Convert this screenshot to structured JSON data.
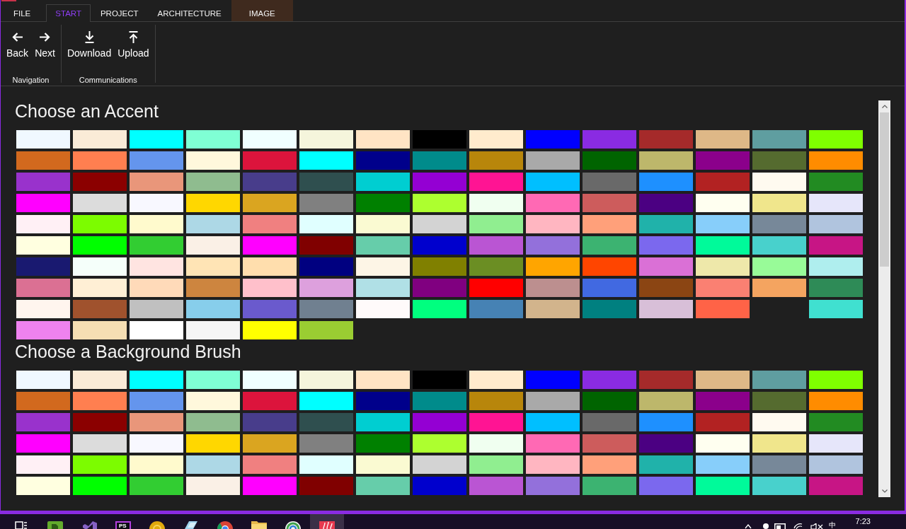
{
  "ribbon": {
    "tabs": [
      {
        "label": "FILE",
        "selected": false,
        "contextual": false
      },
      {
        "label": "START",
        "selected": true,
        "contextual": false
      },
      {
        "label": "PROJECT",
        "selected": false,
        "contextual": false
      },
      {
        "label": "ARCHITECTURE",
        "selected": false,
        "contextual": false
      },
      {
        "label": "IMAGE",
        "selected": false,
        "contextual": true
      }
    ],
    "groups": [
      {
        "label": "Navigation",
        "buttons": [
          {
            "label": "Back",
            "kind": "back"
          },
          {
            "label": "Next",
            "kind": "next"
          }
        ]
      },
      {
        "label": "Communications",
        "buttons": [
          {
            "label": "Download",
            "kind": "download"
          },
          {
            "label": "Upload",
            "kind": "upload"
          }
        ]
      }
    ]
  },
  "sections": [
    {
      "title": "Choose an Accent",
      "swatches": [
        {
          "kind": "swatch",
          "color": "#f0f8ff"
        },
        {
          "kind": "swatch",
          "color": "#faebd7"
        },
        {
          "kind": "swatch",
          "color": "#00ffff"
        },
        {
          "kind": "swatch",
          "color": "#7fffd4"
        },
        {
          "kind": "swatch",
          "color": "#f0ffff"
        },
        {
          "kind": "swatch",
          "color": "#f5f5dc"
        },
        {
          "kind": "swatch",
          "color": "#ffe4c4"
        },
        {
          "kind": "swatch",
          "color": "#000000"
        },
        {
          "kind": "swatch",
          "color": "#ffebcd"
        },
        {
          "kind": "swatch",
          "color": "#0000ff"
        },
        {
          "kind": "swatch",
          "color": "#8a2be2"
        },
        {
          "kind": "swatch",
          "color": "#a52a2a"
        },
        {
          "kind": "swatch",
          "color": "#deb887"
        },
        {
          "kind": "swatch",
          "color": "#5f9ea0"
        },
        {
          "kind": "swatch",
          "color": "#7fff00"
        },
        {
          "kind": "swatch",
          "color": "#d2691e"
        },
        {
          "kind": "swatch",
          "color": "#ff7f50"
        },
        {
          "kind": "swatch",
          "color": "#6495ed"
        },
        {
          "kind": "swatch",
          "color": "#fff8dc"
        },
        {
          "kind": "swatch",
          "color": "#dc143c"
        },
        {
          "kind": "swatch",
          "color": "#00ffff"
        },
        {
          "kind": "swatch",
          "color": "#00008b"
        },
        {
          "kind": "swatch",
          "color": "#008b8b"
        },
        {
          "kind": "swatch",
          "color": "#b8860b"
        },
        {
          "kind": "swatch",
          "color": "#a9a9a9"
        },
        {
          "kind": "swatch",
          "color": "#006400"
        },
        {
          "kind": "swatch",
          "color": "#bdb76b"
        },
        {
          "kind": "swatch",
          "color": "#8b008b"
        },
        {
          "kind": "swatch",
          "color": "#556b2f"
        },
        {
          "kind": "swatch",
          "color": "#ff8c00"
        },
        {
          "kind": "swatch",
          "color": "#9932cc"
        },
        {
          "kind": "swatch",
          "color": "#8b0000"
        },
        {
          "kind": "swatch",
          "color": "#e9967a"
        },
        {
          "kind": "swatch",
          "color": "#8fbc8f"
        },
        {
          "kind": "swatch",
          "color": "#483d8b"
        },
        {
          "kind": "swatch",
          "color": "#2f4f4f"
        },
        {
          "kind": "swatch",
          "color": "#00ced1"
        },
        {
          "kind": "swatch",
          "color": "#9400d3"
        },
        {
          "kind": "swatch",
          "color": "#ff1493"
        },
        {
          "kind": "swatch",
          "color": "#00bfff"
        },
        {
          "kind": "swatch",
          "color": "#696969"
        },
        {
          "kind": "swatch",
          "color": "#1e90ff"
        },
        {
          "kind": "swatch",
          "color": "#b22222"
        },
        {
          "kind": "swatch",
          "color": "#fffaf0"
        },
        {
          "kind": "swatch",
          "color": "#228b22"
        },
        {
          "kind": "swatch",
          "color": "#ff00ff"
        },
        {
          "kind": "swatch",
          "color": "#dcdcdc"
        },
        {
          "kind": "swatch",
          "color": "#f8f8ff"
        },
        {
          "kind": "swatch",
          "color": "#ffd700"
        },
        {
          "kind": "swatch",
          "color": "#daa520"
        },
        {
          "kind": "swatch",
          "color": "#808080"
        },
        {
          "kind": "swatch",
          "color": "#008000"
        },
        {
          "kind": "swatch",
          "color": "#adff2f"
        },
        {
          "kind": "swatch",
          "color": "#f0fff0"
        },
        {
          "kind": "swatch",
          "color": "#ff69b4"
        },
        {
          "kind": "swatch",
          "color": "#cd5c5c"
        },
        {
          "kind": "swatch",
          "color": "#4b0082"
        },
        {
          "kind": "swatch",
          "color": "#fffff0"
        },
        {
          "kind": "swatch",
          "color": "#f0e68c"
        },
        {
          "kind": "swatch",
          "color": "#e6e6fa"
        },
        {
          "kind": "swatch",
          "color": "#fff0f5"
        },
        {
          "kind": "swatch",
          "color": "#7cfc00"
        },
        {
          "kind": "swatch",
          "color": "#fffacd"
        },
        {
          "kind": "swatch",
          "color": "#add8e6"
        },
        {
          "kind": "swatch",
          "color": "#f08080"
        },
        {
          "kind": "swatch",
          "color": "#e0ffff"
        },
        {
          "kind": "swatch",
          "color": "#fafad2"
        },
        {
          "kind": "swatch",
          "color": "#d3d3d3"
        },
        {
          "kind": "swatch",
          "color": "#90ee90"
        },
        {
          "kind": "swatch",
          "color": "#ffb6c1"
        },
        {
          "kind": "swatch",
          "color": "#ffa07a"
        },
        {
          "kind": "swatch",
          "color": "#20b2aa"
        },
        {
          "kind": "swatch",
          "color": "#87cefa"
        },
        {
          "kind": "swatch",
          "color": "#778899"
        },
        {
          "kind": "swatch",
          "color": "#b0c4de"
        },
        {
          "kind": "swatch",
          "color": "#ffffe0"
        },
        {
          "kind": "swatch",
          "color": "#00ff00"
        },
        {
          "kind": "swatch",
          "color": "#32cd32"
        },
        {
          "kind": "swatch",
          "color": "#faf0e6"
        },
        {
          "kind": "swatch",
          "color": "#ff00ff"
        },
        {
          "kind": "swatch",
          "color": "#800000"
        },
        {
          "kind": "swatch",
          "color": "#66cdaa"
        },
        {
          "kind": "swatch",
          "color": "#0000cd"
        },
        {
          "kind": "swatch",
          "color": "#ba55d3"
        },
        {
          "kind": "swatch",
          "color": "#9370db"
        },
        {
          "kind": "swatch",
          "color": "#3cb371"
        },
        {
          "kind": "swatch",
          "color": "#7b68ee"
        },
        {
          "kind": "swatch",
          "color": "#00fa9a"
        },
        {
          "kind": "swatch",
          "color": "#48d1cc"
        },
        {
          "kind": "swatch",
          "color": "#c71585"
        },
        {
          "kind": "swatch",
          "color": "#191970"
        },
        {
          "kind": "swatch",
          "color": "#f5fffa"
        },
        {
          "kind": "swatch",
          "color": "#ffe4e1"
        },
        {
          "kind": "swatch",
          "color": "#ffe4b5"
        },
        {
          "kind": "swatch",
          "color": "#ffdead"
        },
        {
          "kind": "swatch",
          "color": "#000080"
        },
        {
          "kind": "swatch",
          "color": "#fdf5e6"
        },
        {
          "kind": "swatch",
          "color": "#808000"
        },
        {
          "kind": "swatch",
          "color": "#6b8e23"
        },
        {
          "kind": "swatch",
          "color": "#ffa500"
        },
        {
          "kind": "swatch",
          "color": "#ff4500"
        },
        {
          "kind": "swatch",
          "color": "#da70d6"
        },
        {
          "kind": "swatch",
          "color": "#eee8aa"
        },
        {
          "kind": "swatch",
          "color": "#98fb98"
        },
        {
          "kind": "swatch",
          "color": "#afeeee"
        },
        {
          "kind": "swatch",
          "color": "#db7093"
        },
        {
          "kind": "swatch",
          "color": "#ffefd5"
        },
        {
          "kind": "swatch",
          "color": "#ffdab9"
        },
        {
          "kind": "swatch",
          "color": "#cd853f"
        },
        {
          "kind": "swatch",
          "color": "#ffc0cb"
        },
        {
          "kind": "swatch",
          "color": "#dda0dd"
        },
        {
          "kind": "swatch",
          "color": "#b0e0e6"
        },
        {
          "kind": "swatch",
          "color": "#800080"
        },
        {
          "kind": "swatch",
          "color": "#ff0000"
        },
        {
          "kind": "swatch",
          "color": "#bc8f8f"
        },
        {
          "kind": "swatch",
          "color": "#4169e1"
        },
        {
          "kind": "swatch",
          "color": "#8b4513"
        },
        {
          "kind": "swatch",
          "color": "#fa8072"
        },
        {
          "kind": "swatch",
          "color": "#f4a460"
        },
        {
          "kind": "swatch",
          "color": "#2e8b57"
        },
        {
          "kind": "swatch",
          "color": "#fff5ee"
        },
        {
          "kind": "swatch",
          "color": "#a0522d"
        },
        {
          "kind": "swatch",
          "color": "#c0c0c0"
        },
        {
          "kind": "swatch",
          "color": "#87ceeb"
        },
        {
          "kind": "swatch",
          "color": "#6a5acd"
        },
        {
          "kind": "swatch",
          "color": "#708090"
        },
        {
          "kind": "swatch",
          "color": "#fffafa"
        },
        {
          "kind": "swatch",
          "color": "#00ff7f"
        },
        {
          "kind": "swatch",
          "color": "#4682b4"
        },
        {
          "kind": "swatch",
          "color": "#d2b48c"
        },
        {
          "kind": "swatch",
          "color": "#008080"
        },
        {
          "kind": "swatch",
          "color": "#d8bfd8"
        },
        {
          "kind": "swatch",
          "color": "#ff6347"
        },
        {
          "kind": "empty"
        },
        {
          "kind": "swatch",
          "color": "#40e0d0"
        },
        {
          "kind": "swatch",
          "color": "#ee82ee"
        },
        {
          "kind": "swatch",
          "color": "#f5deb3"
        },
        {
          "kind": "swatch",
          "color": "#ffffff"
        },
        {
          "kind": "swatch",
          "color": "#f5f5f5"
        },
        {
          "kind": "swatch",
          "color": "#ffff00"
        },
        {
          "kind": "swatch",
          "color": "#9acd32"
        }
      ]
    },
    {
      "title": "Choose a Background Brush",
      "swatches": [
        {
          "kind": "swatch",
          "color": "#f0f8ff"
        },
        {
          "kind": "swatch",
          "color": "#faebd7"
        },
        {
          "kind": "swatch",
          "color": "#00ffff"
        },
        {
          "kind": "swatch",
          "color": "#7fffd4"
        },
        {
          "kind": "swatch",
          "color": "#f0ffff"
        },
        {
          "kind": "swatch",
          "color": "#f5f5dc"
        },
        {
          "kind": "swatch",
          "color": "#ffe4c4"
        },
        {
          "kind": "swatch",
          "color": "#000000"
        },
        {
          "kind": "swatch",
          "color": "#ffebcd"
        },
        {
          "kind": "swatch",
          "color": "#0000ff"
        },
        {
          "kind": "swatch",
          "color": "#8a2be2"
        },
        {
          "kind": "swatch",
          "color": "#a52a2a"
        },
        {
          "kind": "swatch",
          "color": "#deb887"
        },
        {
          "kind": "swatch",
          "color": "#5f9ea0"
        },
        {
          "kind": "swatch",
          "color": "#7fff00"
        },
        {
          "kind": "swatch",
          "color": "#d2691e"
        },
        {
          "kind": "swatch",
          "color": "#ff7f50"
        },
        {
          "kind": "swatch",
          "color": "#6495ed"
        },
        {
          "kind": "swatch",
          "color": "#fff8dc"
        },
        {
          "kind": "swatch",
          "color": "#dc143c"
        },
        {
          "kind": "swatch",
          "color": "#00ffff"
        },
        {
          "kind": "swatch",
          "color": "#00008b"
        },
        {
          "kind": "swatch",
          "color": "#008b8b"
        },
        {
          "kind": "swatch",
          "color": "#b8860b"
        },
        {
          "kind": "swatch",
          "color": "#a9a9a9"
        },
        {
          "kind": "swatch",
          "color": "#006400"
        },
        {
          "kind": "swatch",
          "color": "#bdb76b"
        },
        {
          "kind": "swatch",
          "color": "#8b008b"
        },
        {
          "kind": "swatch",
          "color": "#556b2f"
        },
        {
          "kind": "swatch",
          "color": "#ff8c00"
        },
        {
          "kind": "swatch",
          "color": "#9932cc"
        },
        {
          "kind": "swatch",
          "color": "#8b0000"
        },
        {
          "kind": "swatch",
          "color": "#e9967a"
        },
        {
          "kind": "swatch",
          "color": "#8fbc8f"
        },
        {
          "kind": "swatch",
          "color": "#483d8b"
        },
        {
          "kind": "swatch",
          "color": "#2f4f4f"
        },
        {
          "kind": "swatch",
          "color": "#00ced1"
        },
        {
          "kind": "swatch",
          "color": "#9400d3"
        },
        {
          "kind": "swatch",
          "color": "#ff1493"
        },
        {
          "kind": "swatch",
          "color": "#00bfff"
        },
        {
          "kind": "swatch",
          "color": "#696969"
        },
        {
          "kind": "swatch",
          "color": "#1e90ff"
        },
        {
          "kind": "swatch",
          "color": "#b22222"
        },
        {
          "kind": "swatch",
          "color": "#fffaf0"
        },
        {
          "kind": "swatch",
          "color": "#228b22"
        },
        {
          "kind": "swatch",
          "color": "#ff00ff"
        },
        {
          "kind": "swatch",
          "color": "#dcdcdc"
        },
        {
          "kind": "swatch",
          "color": "#f8f8ff"
        },
        {
          "kind": "swatch",
          "color": "#ffd700"
        },
        {
          "kind": "swatch",
          "color": "#daa520"
        },
        {
          "kind": "swatch",
          "color": "#808080"
        },
        {
          "kind": "swatch",
          "color": "#008000"
        },
        {
          "kind": "swatch",
          "color": "#adff2f"
        },
        {
          "kind": "swatch",
          "color": "#f0fff0"
        },
        {
          "kind": "swatch",
          "color": "#ff69b4"
        },
        {
          "kind": "swatch",
          "color": "#cd5c5c"
        },
        {
          "kind": "swatch",
          "color": "#4b0082"
        },
        {
          "kind": "swatch",
          "color": "#fffff0"
        },
        {
          "kind": "swatch",
          "color": "#f0e68c"
        },
        {
          "kind": "swatch",
          "color": "#e6e6fa"
        },
        {
          "kind": "swatch",
          "color": "#fff0f5"
        },
        {
          "kind": "swatch",
          "color": "#7cfc00"
        },
        {
          "kind": "swatch",
          "color": "#fffacd"
        },
        {
          "kind": "swatch",
          "color": "#add8e6"
        },
        {
          "kind": "swatch",
          "color": "#f08080"
        },
        {
          "kind": "swatch",
          "color": "#e0ffff"
        },
        {
          "kind": "swatch",
          "color": "#fafad2"
        },
        {
          "kind": "swatch",
          "color": "#d3d3d3"
        },
        {
          "kind": "swatch",
          "color": "#90ee90"
        },
        {
          "kind": "swatch",
          "color": "#ffb6c1"
        },
        {
          "kind": "swatch",
          "color": "#ffa07a"
        },
        {
          "kind": "swatch",
          "color": "#20b2aa"
        },
        {
          "kind": "swatch",
          "color": "#87cefa"
        },
        {
          "kind": "swatch",
          "color": "#778899"
        },
        {
          "kind": "swatch",
          "color": "#b0c4de"
        },
        {
          "kind": "swatch",
          "color": "#ffffe0"
        },
        {
          "kind": "swatch",
          "color": "#00ff00"
        },
        {
          "kind": "swatch",
          "color": "#32cd32"
        },
        {
          "kind": "swatch",
          "color": "#faf0e6"
        },
        {
          "kind": "swatch",
          "color": "#ff00ff"
        },
        {
          "kind": "swatch",
          "color": "#800000"
        },
        {
          "kind": "swatch",
          "color": "#66cdaa"
        },
        {
          "kind": "swatch",
          "color": "#0000cd"
        },
        {
          "kind": "swatch",
          "color": "#ba55d3"
        },
        {
          "kind": "swatch",
          "color": "#9370db"
        },
        {
          "kind": "swatch",
          "color": "#3cb371"
        },
        {
          "kind": "swatch",
          "color": "#7b68ee"
        },
        {
          "kind": "swatch",
          "color": "#00fa9a"
        },
        {
          "kind": "swatch",
          "color": "#48d1cc"
        },
        {
          "kind": "swatch",
          "color": "#c71585"
        }
      ]
    }
  ],
  "taskbar": {
    "apps": [
      {
        "kind": "note",
        "active": false
      },
      {
        "kind": "ribbon",
        "active": false
      },
      {
        "kind": "tile",
        "label": "PS",
        "active": false
      },
      {
        "kind": "coin",
        "active": false
      },
      {
        "kind": "crystal",
        "active": false
      },
      {
        "kind": "browser",
        "active": false
      },
      {
        "kind": "folder",
        "active": false
      },
      {
        "kind": "globe",
        "active": false
      },
      {
        "kind": "flame",
        "active": true
      }
    ],
    "input_mode": "中",
    "clock": "7:23"
  }
}
